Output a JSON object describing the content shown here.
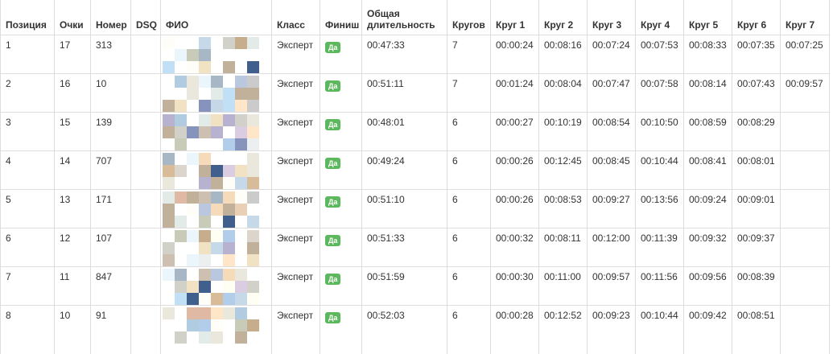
{
  "headers": [
    "Позиция",
    "Очки",
    "Номер",
    "DSQ",
    "ФИО",
    "Класс",
    "Финиш",
    "Общая длительность",
    "Кругов",
    "Круг 1",
    "Круг 2",
    "Круг 3",
    "Круг 4",
    "Круг 5",
    "Круг 6",
    "Круг 7"
  ],
  "finish_badge_color": "#5cb85c",
  "rows": [
    {
      "pos": "1",
      "points": "17",
      "number": "313",
      "dsq": "",
      "class": "Эксперт",
      "finish": "Да",
      "total": "00:47:33",
      "laps": "7",
      "lap_times": [
        "00:00:24",
        "00:08:16",
        "00:07:24",
        "00:07:53",
        "00:08:33",
        "00:07:35",
        "00:07:25"
      ]
    },
    {
      "pos": "2",
      "points": "16",
      "number": "10",
      "dsq": "",
      "class": "Эксперт",
      "finish": "Да",
      "total": "00:51:11",
      "laps": "7",
      "lap_times": [
        "00:01:24",
        "00:08:04",
        "00:07:47",
        "00:07:58",
        "00:08:14",
        "00:07:43",
        "00:09:57"
      ]
    },
    {
      "pos": "3",
      "points": "15",
      "number": "139",
      "dsq": "",
      "class": "Эксперт",
      "finish": "Да",
      "total": "00:48:01",
      "laps": "6",
      "lap_times": [
        "00:00:27",
        "00:10:19",
        "00:08:54",
        "00:10:50",
        "00:08:59",
        "00:08:29",
        ""
      ]
    },
    {
      "pos": "4",
      "points": "14",
      "number": "707",
      "dsq": "",
      "class": "Эксперт",
      "finish": "Да",
      "total": "00:49:24",
      "laps": "6",
      "lap_times": [
        "00:00:26",
        "00:12:45",
        "00:08:45",
        "00:10:44",
        "00:08:41",
        "00:08:01",
        ""
      ]
    },
    {
      "pos": "5",
      "points": "13",
      "number": "171",
      "dsq": "",
      "class": "Эксперт",
      "finish": "Да",
      "total": "00:51:10",
      "laps": "6",
      "lap_times": [
        "00:00:26",
        "00:08:53",
        "00:09:27",
        "00:13:56",
        "00:09:24",
        "00:09:01",
        ""
      ]
    },
    {
      "pos": "6",
      "points": "12",
      "number": "107",
      "dsq": "",
      "class": "Эксперт",
      "finish": "Да",
      "total": "00:51:33",
      "laps": "6",
      "lap_times": [
        "00:00:32",
        "00:08:11",
        "00:12:00",
        "00:11:39",
        "00:09:32",
        "00:09:37",
        ""
      ]
    },
    {
      "pos": "7",
      "points": "11",
      "number": "847",
      "dsq": "",
      "class": "Эксперт",
      "finish": "Да",
      "total": "00:51:59",
      "laps": "6",
      "lap_times": [
        "00:00:30",
        "00:11:00",
        "00:09:57",
        "00:11:56",
        "00:09:56",
        "00:08:39",
        ""
      ]
    },
    {
      "pos": "8",
      "points": "10",
      "number": "91",
      "dsq": "",
      "class": "Эксперт",
      "finish": "Да",
      "total": "00:52:03",
      "laps": "6",
      "lap_times": [
        "00:00:28",
        "00:12:52",
        "00:09:23",
        "00:10:44",
        "00:09:42",
        "00:08:51",
        ""
      ]
    }
  ]
}
